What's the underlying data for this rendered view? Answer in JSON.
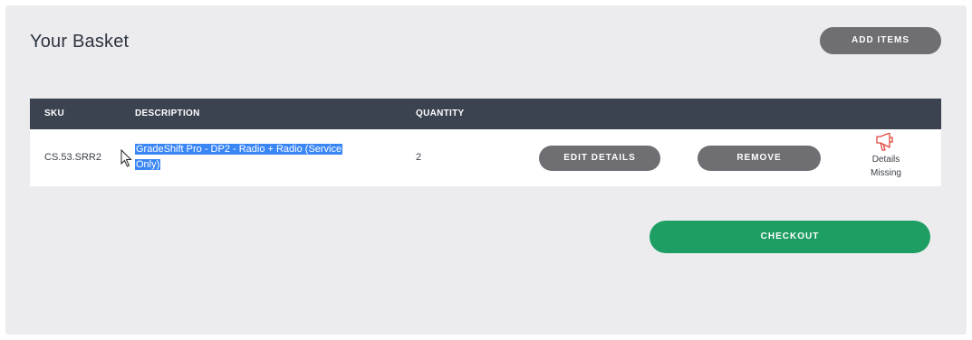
{
  "page": {
    "title": "Your Basket",
    "add_items_label": "ADD ITEMS",
    "checkout_label": "CHECKOUT"
  },
  "table": {
    "columns": {
      "sku": "SKU",
      "description": "DESCRIPTION",
      "quantity": "QUANTITY"
    },
    "rows": [
      {
        "sku": "CS.53.SRR2",
        "description_line1": "GradeShift Pro - DP2 - Radio + Radio (Service",
        "description_line2": "Only)",
        "quantity": "2",
        "edit_label": "EDIT DETAILS",
        "remove_label": "REMOVE",
        "status_line1": "Details",
        "status_line2": "Missing",
        "status_icon": "megaphone-icon"
      }
    ]
  },
  "colors": {
    "header_bg": "#3c4350",
    "button_gray": "#6e6e73",
    "checkout_green": "#1e9e63",
    "selection_blue": "#3a86f5",
    "warning_red": "#e0463c"
  }
}
